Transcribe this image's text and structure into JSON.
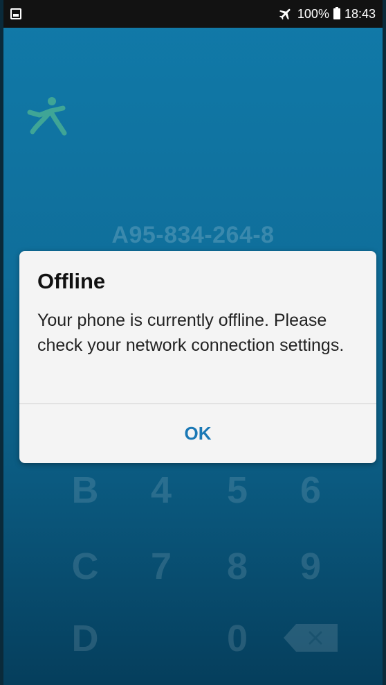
{
  "status_bar": {
    "battery": "100%",
    "time": "18:43",
    "icons": [
      "gallery-icon",
      "airplane-mode-icon",
      "battery-icon"
    ]
  },
  "account": {
    "id": "A95-834-264-8"
  },
  "keypad": {
    "row2": [
      "B",
      "4",
      "5",
      "6"
    ],
    "row3": [
      "C",
      "7",
      "8",
      "9"
    ],
    "row4": [
      "D",
      "0"
    ]
  },
  "dialog": {
    "title": "Offline",
    "message": "Your phone is currently offline. Please check your network connection settings.",
    "ok_label": "OK"
  },
  "colors": {
    "accent": "#1a78b5",
    "background_top": "#117aa9",
    "background_bottom": "#053e5c",
    "logo": "#3fa596"
  }
}
